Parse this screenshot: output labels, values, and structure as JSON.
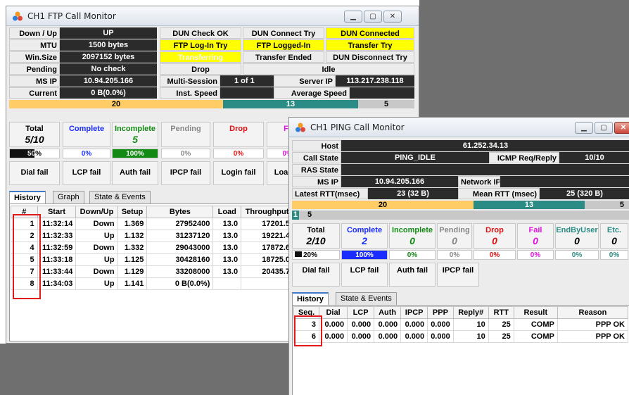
{
  "ftp": {
    "title": "CH1 FTP Call Monitor",
    "rows": {
      "down_up": {
        "label": "Down / Up",
        "value": "UP"
      },
      "mtu": {
        "label": "MTU",
        "value": "1500 bytes"
      },
      "win_size": {
        "label": "Win.Size",
        "value": "2097152 bytes"
      },
      "pending": {
        "label": "Pending",
        "value": "No check"
      },
      "ms_ip": {
        "label": "MS IP",
        "value": "10.94.205.166"
      },
      "current": {
        "label": "Current",
        "value": "0 B(0.0%)"
      }
    },
    "states": {
      "dun_check_ok": "DUN Check OK",
      "dun_connect_try": "DUN Connect Try",
      "dun_connected": "DUN Connected",
      "ftp_login_try": "FTP Log-In Try",
      "ftp_logged_in": "FTP Logged-In",
      "transfer_try": "Transfer Try",
      "transferring": "Transferring",
      "transfer_ended": "Transfer Ended",
      "dun_disconnect_try": "DUN Disconnect Try",
      "drop": "Drop",
      "idle": "Idle",
      "multi_session_label": "Multi-Session",
      "multi_session_value": "1 of 1",
      "server_ip_label": "Server IP",
      "server_ip_value": "113.217.238.118",
      "inst_speed": "Inst. Speed",
      "average_speed": "Average Speed"
    },
    "bar": {
      "orange": "20",
      "teal": "13",
      "gray": "5"
    },
    "stats": {
      "total_label": "Total",
      "total_value": "5/10",
      "total_pct": "50%",
      "complete_label": "Complete",
      "complete_pct": "0%",
      "incomplete_label": "Incomplete",
      "incomplete_value": "5",
      "incomplete_pct": "100%",
      "pending_label": "Pending",
      "pending_pct": "0%",
      "drop_label": "Drop",
      "drop_pct": "0%",
      "fail_label": "Fa",
      "fail_pct": "0%"
    },
    "fails": [
      "Dial fail",
      "LCP fail",
      "Auth fail",
      "IPCP fail",
      "Login fail",
      "Load"
    ],
    "tabs": [
      "History",
      "Graph",
      "State & Events"
    ],
    "columns": [
      "#",
      "Start",
      "Down/Up",
      "Setup",
      "Bytes",
      "Load",
      "Throughput"
    ],
    "history": [
      [
        "1",
        "11:32:14",
        "Down",
        "1.369",
        "27952400",
        "13.0",
        "17201.5"
      ],
      [
        "2",
        "11:32:33",
        "Up",
        "1.132",
        "31237120",
        "13.0",
        "19221.4"
      ],
      [
        "4",
        "11:32:59",
        "Down",
        "1.332",
        "29043000",
        "13.0",
        "17872.6"
      ],
      [
        "5",
        "11:33:18",
        "Up",
        "1.125",
        "30428160",
        "13.0",
        "18725.0"
      ],
      [
        "7",
        "11:33:44",
        "Down",
        "1.129",
        "33208000",
        "13.0",
        "20435.7"
      ],
      [
        "8",
        "11:34:03",
        "Up",
        "1.141",
        "0 B(0.0%)",
        "",
        ""
      ]
    ]
  },
  "ping": {
    "title": "CH1 PING Call Monitor",
    "host_label": "Host",
    "host_value": "61.252.34.13",
    "call_state_label": "Call State",
    "call_state_value": "PING_IDLE",
    "icmp_label": "ICMP Req/Reply",
    "icmp_value": "10/10",
    "ras_state_label": "RAS State",
    "ms_ip_label": "MS IP",
    "ms_ip_value": "10.94.205.166",
    "network_ip_label": "Network IP",
    "latest_rtt_label": "Latest RTT(msec)",
    "latest_rtt_value": "23 (32 B)",
    "mean_rtt_label": "Mean RTT (msec)",
    "mean_rtt_value": "25 (320 B)",
    "bar": {
      "orange": "20",
      "teal": "13",
      "gray": "5"
    },
    "bar2": {
      "a": "1",
      "b": "5"
    },
    "stats": {
      "total_label": "Total",
      "total_value": "2/10",
      "total_pct": "20%",
      "complete_label": "Complete",
      "complete_value": "2",
      "complete_pct": "100%",
      "incomplete_label": "Incomplete",
      "incomplete_value": "0",
      "incomplete_pct": "0%",
      "pending_label": "Pending",
      "pending_value": "0",
      "pending_pct": "0%",
      "drop_label": "Drop",
      "drop_value": "0",
      "drop_pct": "0%",
      "fail_label": "Fail",
      "fail_value": "0",
      "fail_pct": "0%",
      "endbyuser_label": "EndByUser",
      "endbyuser_value": "0",
      "endbyuser_pct": "0%",
      "etc_label": "Etc.",
      "etc_value": "0",
      "etc_pct": "0%"
    },
    "fails": [
      "Dial fail",
      "LCP fail",
      "Auth fail",
      "IPCP fail"
    ],
    "tabs": [
      "History",
      "State & Events"
    ],
    "columns": [
      "Seq.",
      "Dial",
      "LCP",
      "Auth",
      "IPCP",
      "PPP",
      "Reply#",
      "RTT",
      "Result",
      "Reason"
    ],
    "history": [
      [
        "3",
        "0.000",
        "0.000",
        "0.000",
        "0.000",
        "0.000",
        "10",
        "25",
        "COMP",
        "PPP OK"
      ],
      [
        "6",
        "0.000",
        "0.000",
        "0.000",
        "0.000",
        "0.000",
        "10",
        "25",
        "COMP",
        "PPP OK"
      ]
    ]
  },
  "colors": {
    "accent_yellow": "#ffff00",
    "bar_orange": "#ffcc66",
    "bar_teal": "#2a8c84",
    "complete_blue": "#1a2cff",
    "incomplete_green": "#138a13",
    "drop_red": "#e01010",
    "fail_magenta": "#e010e0",
    "highlight_red": "#e0191b"
  }
}
